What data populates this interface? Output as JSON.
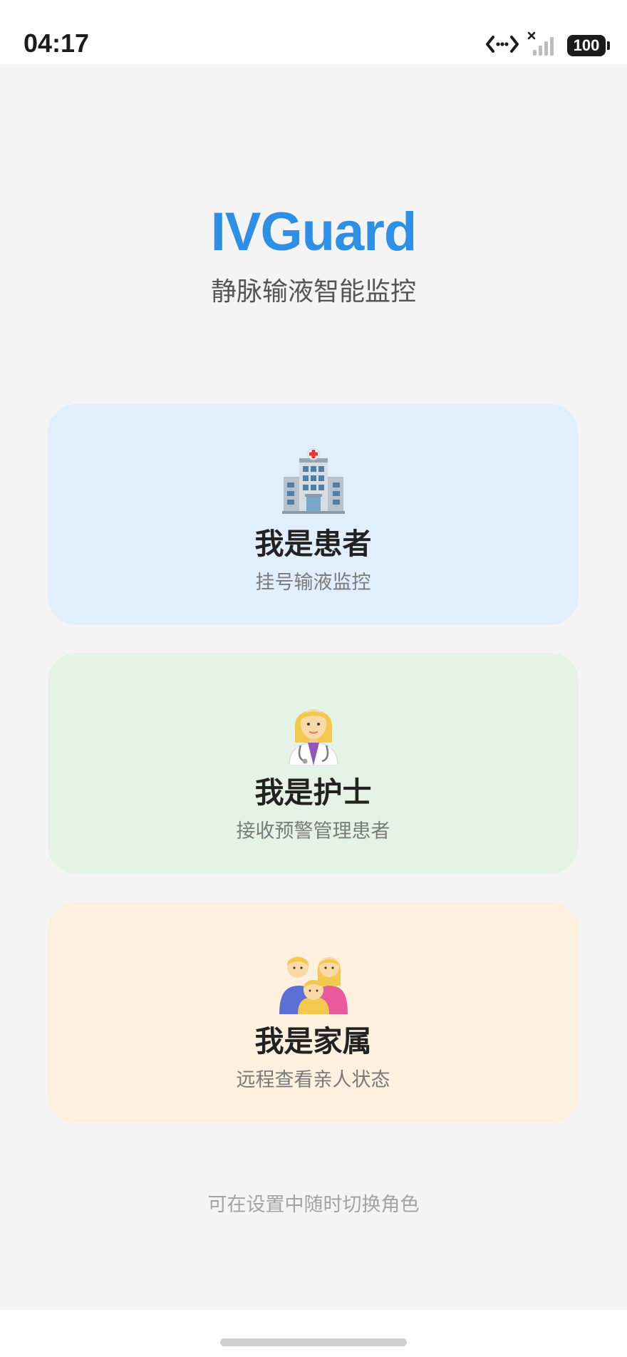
{
  "status_bar": {
    "time": "04:17",
    "battery": "100",
    "icons": [
      "data-transfer-icon",
      "signal-icon",
      "battery-icon"
    ]
  },
  "header": {
    "title": "IVGuard",
    "subtitle": "静脉输液智能监控"
  },
  "roles": [
    {
      "icon": "hospital-icon",
      "title": "我是患者",
      "description": "挂号输液监控",
      "color": "#e1effc"
    },
    {
      "icon": "nurse-icon",
      "title": "我是护士",
      "description": "接收预警管理患者",
      "color": "#e5f3e6"
    },
    {
      "icon": "family-icon",
      "title": "我是家属",
      "description": "远程查看亲人状态",
      "color": "#fdf0df"
    }
  ],
  "footer": {
    "hint": "可在设置中随时切换角色"
  },
  "colors": {
    "accent": "#2e8fe6",
    "background": "#f4f4f4"
  }
}
